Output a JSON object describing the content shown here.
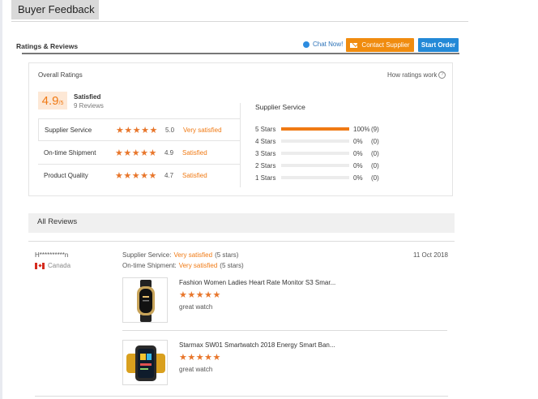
{
  "page": {
    "tab_title": "Buyer Feedback"
  },
  "ratings_header": {
    "title": "Ratings & Reviews",
    "chat_label": "Chat Now!",
    "contact_label": "Contact Supplier",
    "order_label": "Start Order"
  },
  "overall": {
    "title": "Overall Ratings",
    "how_label": "How ratings work",
    "score": "4.9",
    "score_suffix": "/5",
    "status": "Satisfied",
    "reviews_count": "9 Reviews",
    "rows": [
      {
        "label": "Supplier Service",
        "stars": "★★★★★",
        "score": "5.0",
        "text": "Very satisfied"
      },
      {
        "label": "On-time Shipment",
        "stars": "★★★★★",
        "score": "4.9",
        "text": "Satisfied"
      },
      {
        "label": "Product Quality",
        "stars": "★★★★★",
        "score": "4.7",
        "text": "Satisfied"
      }
    ],
    "accent_color": "#f07a14"
  },
  "supplier_service": {
    "title": "Supplier Service",
    "bars": [
      {
        "label": "5 Stars",
        "percent": 100,
        "percent_text": "100%",
        "count": "(9)"
      },
      {
        "label": "4 Stars",
        "percent": 0,
        "percent_text": "0%",
        "count": "(0)"
      },
      {
        "label": "3 Stars",
        "percent": 0,
        "percent_text": "0%",
        "count": "(0)"
      },
      {
        "label": "2 Stars",
        "percent": 0,
        "percent_text": "0%",
        "count": "(0)"
      },
      {
        "label": "1 Stars",
        "percent": 0,
        "percent_text": "0%",
        "count": "(0)"
      }
    ]
  },
  "all_reviews": {
    "title": "All Reviews",
    "review": {
      "reviewer": "H**********n",
      "country": "Canada",
      "date": "11 Oct 2018",
      "service_label": "Supplier Service:",
      "service_value": "Very satisfied",
      "service_stars": "(5 stars)",
      "shipment_label": "On-time Shipment:",
      "shipment_value": "Very satisfied",
      "shipment_stars": "(5 stars)",
      "products": [
        {
          "title": "Fashion Women Ladies Heart Rate Monitor S3 Smar...",
          "stars": "★★★★★",
          "comment": "great watch"
        },
        {
          "title": "Starmax SW01 Smartwatch 2018 Energy Smart Ban...",
          "stars": "★★★★★",
          "comment": "great watch"
        }
      ]
    }
  }
}
